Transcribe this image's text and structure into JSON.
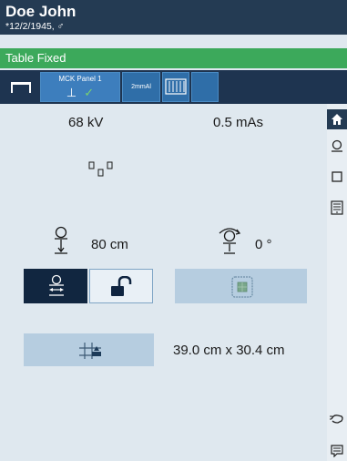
{
  "patient": {
    "name": "Doe John",
    "dob": "*12/2/1945, ♂"
  },
  "status": "Table Fixed",
  "toolbar": {
    "panel_label": "MCK Panel 1",
    "filter_label": "2mmAl"
  },
  "exposure": {
    "kv": "68 kV",
    "mas": "0.5 mAs"
  },
  "geometry": {
    "distance": "80 cm",
    "angle": "0 °"
  },
  "field_size": "39.0 cm x 30.4 cm",
  "icons": [
    "home-icon",
    "tube-icon",
    "square-icon",
    "grid-icon",
    "hand-icon",
    "message-icon",
    "lock-open-icon",
    "table-icon",
    "detector-icon",
    "collimation-icon"
  ]
}
